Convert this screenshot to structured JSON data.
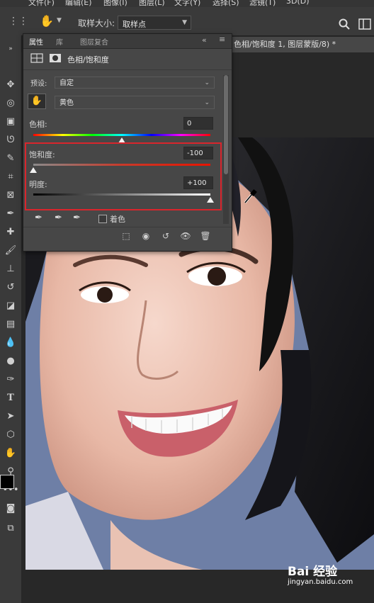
{
  "menu": [
    "文件(F)",
    "编辑(E)",
    "图像(I)",
    "图层(L)",
    "文字(Y)",
    "选择(S)",
    "滤镜(T)",
    "3D(D)"
  ],
  "options_bar": {
    "sample_size_label": "取样大小:",
    "sample_size_value": "取样点"
  },
  "document_tab": "色相/饱和度 1, 图层蒙版/8) *",
  "panel": {
    "tabs": [
      "属性",
      "库",
      "图层复合"
    ],
    "title": "色相/饱和度",
    "preset_label": "预设:",
    "preset_value": "自定",
    "channel_value": "黄色",
    "hue": {
      "label": "色相:",
      "value": "0",
      "level": 0.5
    },
    "saturation": {
      "label": "饱和度:",
      "value": "-100",
      "level": 0.0
    },
    "lightness": {
      "label": "明度:",
      "value": "+100",
      "level": 1.0
    },
    "colorize_label": "着色"
  },
  "watermark": {
    "brand": "Bai 经验",
    "url": "jingyan.baidu.com"
  },
  "colors": {
    "highlight": "#d9252c",
    "panel_bg": "#474747"
  }
}
